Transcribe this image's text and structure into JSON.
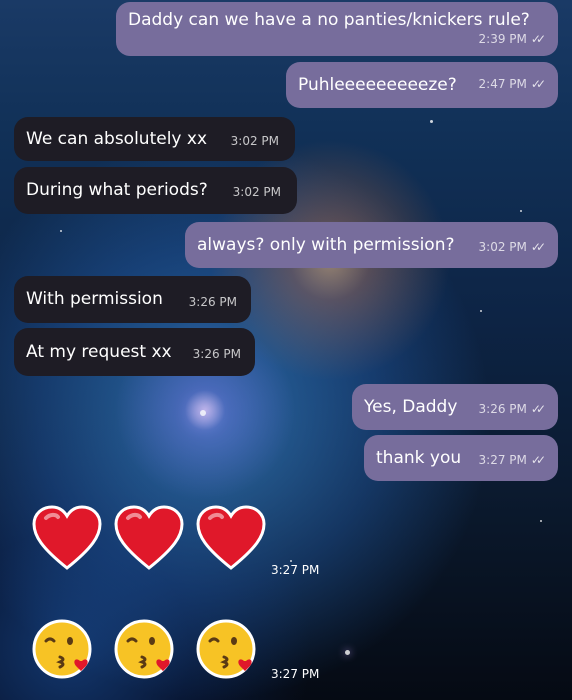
{
  "messages": [
    {
      "dir": "out",
      "text": "Daddy can we have a no panties/knickers rule?",
      "time": "2:39 PM"
    },
    {
      "dir": "out",
      "text": "Puhleeeeeeeeeze?",
      "time": "2:47 PM"
    },
    {
      "dir": "in",
      "text": "We can absolutely xx",
      "time": "3:02 PM"
    },
    {
      "dir": "in",
      "text": "During what periods?",
      "time": "3:02 PM"
    },
    {
      "dir": "out",
      "text": "always? only with permission?",
      "time": "3:02 PM"
    },
    {
      "dir": "in",
      "text": "With permission",
      "time": "3:26 PM"
    },
    {
      "dir": "in",
      "text": "At my request xx",
      "time": "3:26 PM"
    },
    {
      "dir": "out",
      "text": "Yes, Daddy",
      "time": "3:26 PM"
    },
    {
      "dir": "out",
      "text": "thank you",
      "time": "3:27 PM"
    }
  ],
  "emoji_messages": [
    {
      "emoji": "red-heart x3",
      "time": "3:27 PM"
    },
    {
      "emoji": "kissing-face-with-heart x3",
      "time": "3:27 PM"
    }
  ],
  "colors": {
    "outgoing_bubble": "#776d9c",
    "incoming_bubble": "#1e1c25",
    "text": "#ffffff"
  },
  "icons": {
    "read_receipt": "double-check-icon",
    "heart": "red-heart-icon",
    "kiss": "kissing-face-icon"
  }
}
